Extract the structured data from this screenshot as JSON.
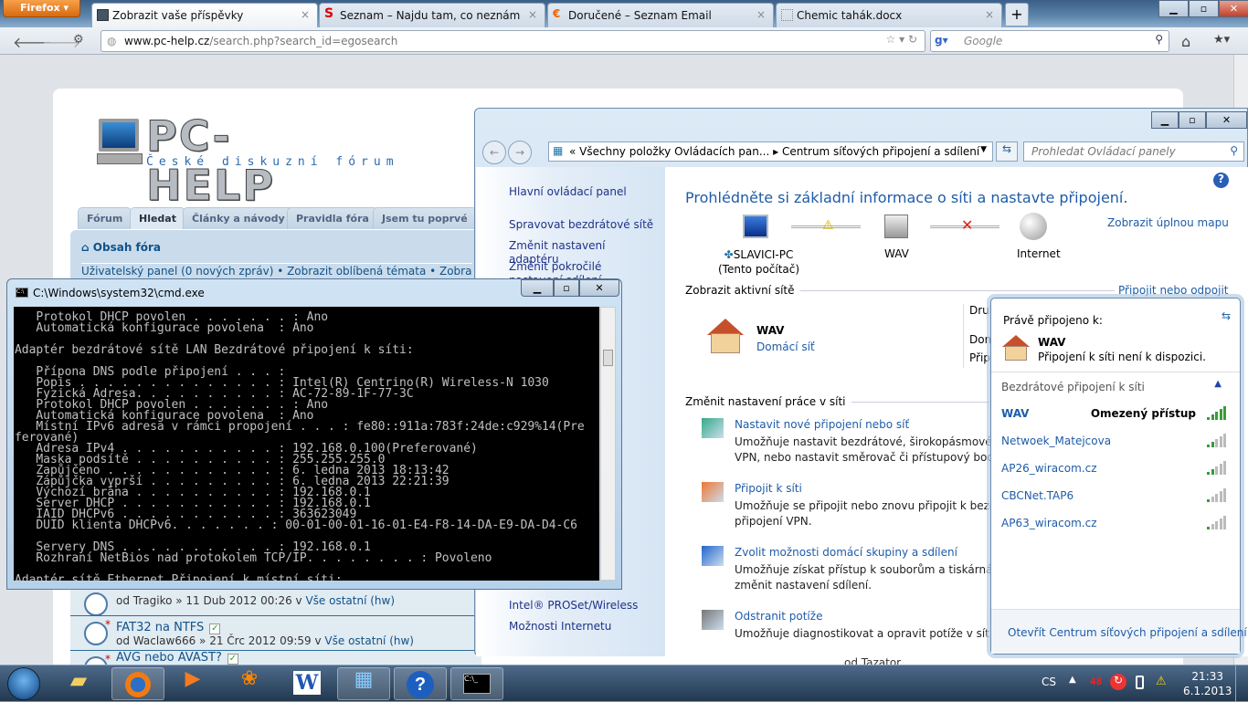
{
  "browser": {
    "menu_button": "Firefox",
    "tabs": [
      {
        "title": "Zobrazit vaše příspěvky",
        "active": true
      },
      {
        "title": "Seznam – Najdu tam, co neznám"
      },
      {
        "title": "Doručené – Seznam Email"
      },
      {
        "title": "Chemic tahák.docx"
      }
    ],
    "new_tab": "+",
    "url_host": "www.pc-help.cz",
    "url_path": "/search.php?search_id=egosearch",
    "search_placeholder": "Google"
  },
  "forum": {
    "logo_title": "PC-HELP",
    "logo_subtitle": "České diskuzní fórum",
    "tabs": [
      "Fórum",
      "Hledat",
      "Články a návody",
      "Pravidla fóra",
      "Jsem tu poprvé"
    ],
    "breadcrumb": "Obsah fóra",
    "user_panel": "Uživatelský panel (0 nových zpráv) • Zobrazit oblíbená témata • Zobraz",
    "topics": [
      {
        "title": "",
        "byline_prefix": "od Tragiko » 11 Dub 2012 00:26 v ",
        "category": "Vše ostatní (hw)"
      },
      {
        "title": "FAT32 na NTFS",
        "byline_prefix": "od Waclaw666 » 21 Črc 2012 09:59 v ",
        "category": "Vše ostatní (hw)"
      },
      {
        "title": "AVG nebo AVAST?",
        "byline_prefix": "",
        "category": ""
      }
    ],
    "hidden_row_author": "od Tazator"
  },
  "control_panel": {
    "breadcrumb_parent": "Všechny položky Ovládacích pan...",
    "breadcrumb_current": "Centrum síťových připojení a sdílení",
    "search_placeholder": "Prohledat Ovládací panely",
    "left_nav": [
      "Hlavní ovládací panel",
      "Spravovat bezdrátové sítě",
      "Změnit nastavení adaptéru",
      "Změnit pokročilé nastavení sdílení",
      "Intel® PROSet/Wireless",
      "Možnosti Internetu"
    ],
    "heading": "Prohlédněte si základní informace o síti a nastavte připojení.",
    "full_map": "Zobrazit úplnou mapu",
    "map": {
      "computer": "SLAVICI-PC",
      "computer_sub": "(Tento počítač)",
      "network": "WAV",
      "internet": "Internet"
    },
    "active_section": "Zobrazit aktivní sítě",
    "connect_link": "Připojit nebo odpojit",
    "active_network": {
      "name": "WAV",
      "type": "Domácí síť"
    },
    "right_labels": [
      "Druh přístupu:",
      "Domácí skupina:",
      "Připojení:"
    ],
    "change_section": "Změnit nastavení práce v síti",
    "tasks": [
      {
        "title": "Nastavit nové připojení nebo síť",
        "desc1": "Umožňuje nastavit bezdrátové, širokopásmové, vytá",
        "desc2": "VPN, nebo nastavit směrovač či přístupový bod."
      },
      {
        "title": "Připojit k síti",
        "desc1": "Umožňuje se připojit nebo znovu připojit k bezdráto",
        "desc2": "připojení VPN."
      },
      {
        "title": "Zvolit možnosti domácí skupiny a sdílení",
        "desc1": "Umožňuje získat přístup k souborům a tiskárnám na",
        "desc2": "změnit nastavení sdílení."
      },
      {
        "title": "Odstranit potíže",
        "desc1": "Umožňuje diagnostikovat a opravit potíže v síti nebo",
        "desc2": ""
      }
    ]
  },
  "cmd": {
    "title": "C:\\Windows\\system32\\cmd.exe",
    "lines": [
      "   Protokol DHCP povolen . . . . . . . : Ano",
      "   Automatická konfigurace povolena  : Ano",
      "",
      "Adaptér bezdrátové sítě LAN Bezdrátové připojení k síti:",
      "",
      "   Přípona DNS podle připojení . . . :",
      "   Popis . . . . . . . . . . . . . . : Intel(R) Centrino(R) Wireless-N 1030",
      "   Fyzická Adresa. . . . . . . . . . : AC-72-89-1F-77-3C",
      "   Protokol DHCP povolen . . . . . . . : Ano",
      "   Automatická konfigurace povolena  : Ano",
      "   Místní IPv6 adresa v rámci propojení . . . : fe80::911a:783f:24de:c929%14(Pre",
      "ferované)",
      "   Adresa IPv4 . . . . . . . . . . . : 192.168.0.100(Preferované)",
      "   Maska podsítě . . . . . . . . . . : 255.255.255.0",
      "   Zapůjčeno . . . . . . . . . . . . : 6. ledna 2013 18:13:42",
      "   Zápůjčka vyprší . . . . . . . . . : 6. ledna 2013 22:21:39",
      "   Výchozí brána . . . . . . . . . . : 192.168.0.1",
      "   Server DHCP . . . . . . . . . . . : 192.168.0.1",
      "   IAID DHCPv6 . . . . . . . . . . . : 363623049",
      "   DUID klienta DHCPv6. . . . . . . : 00-01-00-01-16-01-E4-F8-14-DA-E9-DA-D4-C6",
      "",
      "   Servery DNS . . . . . . . . . . . : 192.168.0.1",
      "   Rozhraní NetBios nad protokolem TCP/IP. . . . . . . . : Povoleno",
      "",
      "Adaptér sítě Ethernet Připojení k místní síti:"
    ]
  },
  "wifi": {
    "connected_label": "Právě připojeno k:",
    "network": "WAV",
    "status": "Připojení k síti není k dispozici.",
    "section": "Bezdrátové připojení k síti",
    "networks": [
      {
        "name": "WAV",
        "status": "Omezený přístup",
        "signal": 5
      },
      {
        "name": "Netwoek_Matejcova",
        "status": "",
        "signal": 2
      },
      {
        "name": "AP26_wiracom.cz",
        "status": "",
        "signal": 2
      },
      {
        "name": "CBCNet.TAP6",
        "status": "",
        "signal": 1
      },
      {
        "name": "AP63_wiracom.cz",
        "status": "",
        "signal": 1
      }
    ],
    "footer": "Otevřít Centrum síťových připojení a sdílení"
  },
  "taskbar": {
    "language": "CS",
    "tray_badge": "48",
    "time": "21:33",
    "date": "6.1.2013"
  },
  "colors": {
    "link": "#1e5ca8",
    "signal_on": "#3a9a3a",
    "signal_off": "#bbbbbb"
  }
}
